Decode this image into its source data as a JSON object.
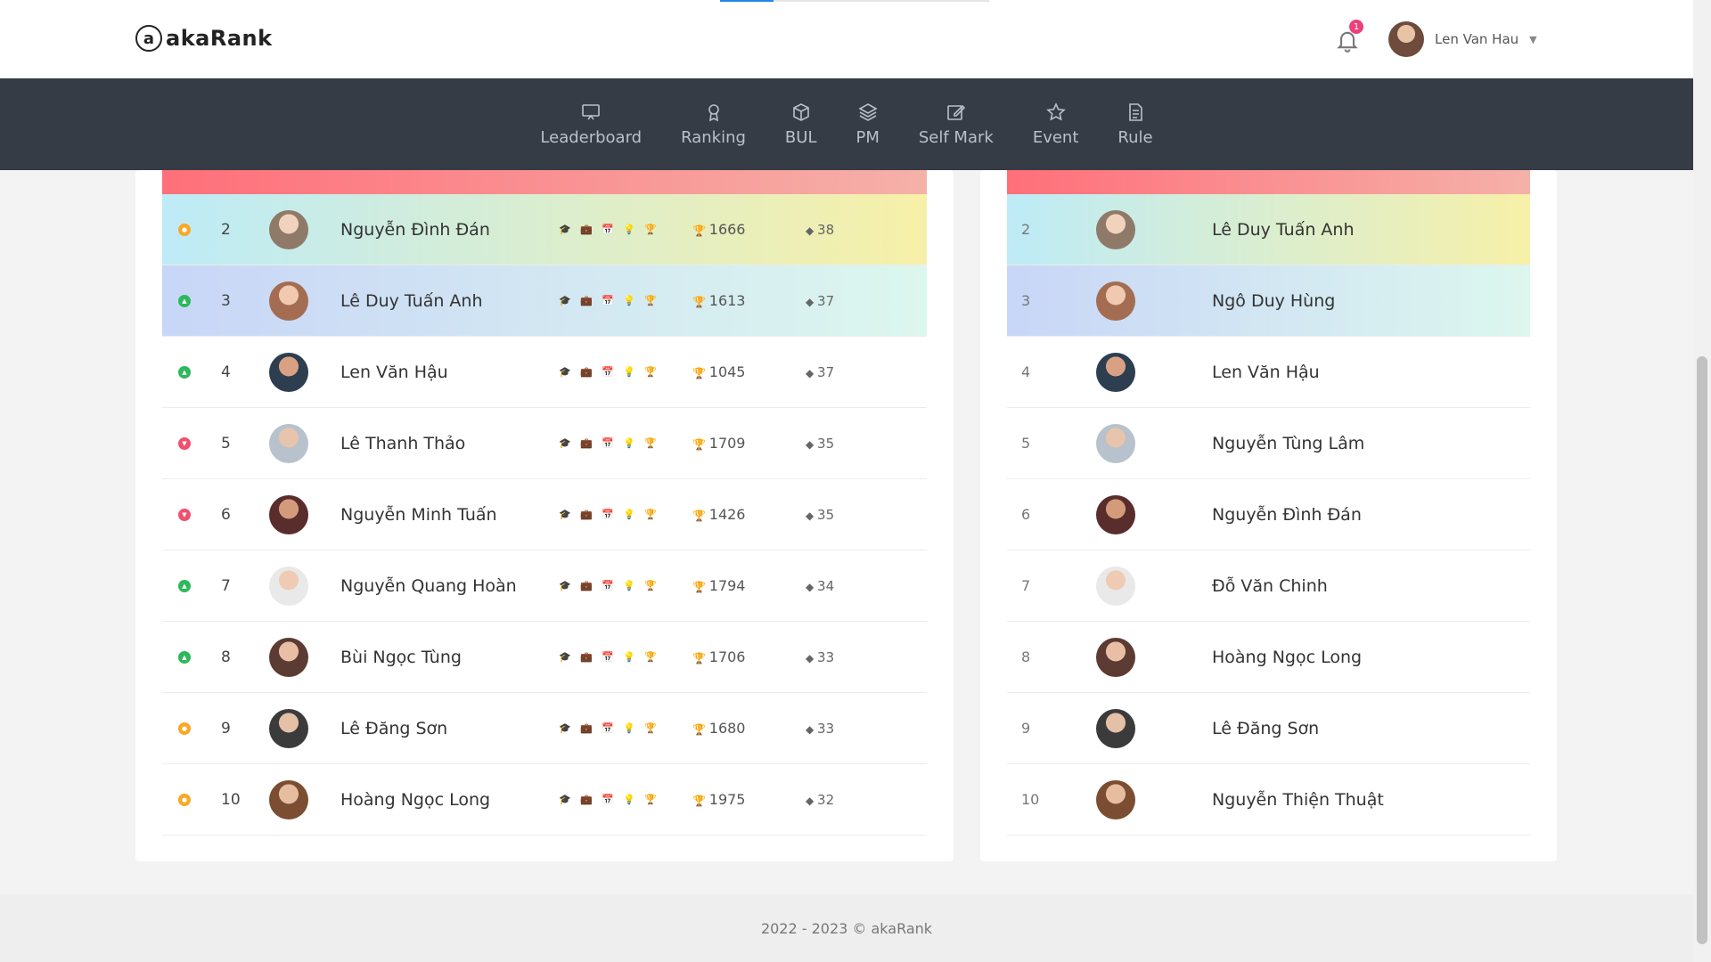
{
  "app": {
    "logo_text": "akaRank",
    "logo_mark": "a"
  },
  "header": {
    "notifications": "1",
    "user_name": "Len Van Hau"
  },
  "nav": [
    {
      "label": "Leaderboard",
      "icon": "monitor-icon"
    },
    {
      "label": "Ranking",
      "icon": "award-icon"
    },
    {
      "label": "BUL",
      "icon": "box-icon"
    },
    {
      "label": "PM",
      "icon": "layers-icon"
    },
    {
      "label": "Self Mark",
      "icon": "edit-icon"
    },
    {
      "label": "Event",
      "icon": "star-icon"
    },
    {
      "label": "Rule",
      "icon": "document-icon"
    }
  ],
  "left_table": [
    {
      "trend": "neutral",
      "rank": "2",
      "name": "Nguyễn Đình Đán",
      "points": "1666",
      "gems": "38",
      "highlight": "yellow"
    },
    {
      "trend": "up",
      "rank": "3",
      "name": "Lê Duy Tuấn Anh",
      "points": "1613",
      "gems": "37",
      "highlight": "teal"
    },
    {
      "trend": "up",
      "rank": "4",
      "name": "Len Văn Hậu",
      "points": "1045",
      "gems": "37",
      "highlight": "none"
    },
    {
      "trend": "down",
      "rank": "5",
      "name": "Lê Thanh Thảo",
      "points": "1709",
      "gems": "35",
      "highlight": "none"
    },
    {
      "trend": "down",
      "rank": "6",
      "name": "Nguyễn Minh Tuấn",
      "points": "1426",
      "gems": "35",
      "highlight": "none"
    },
    {
      "trend": "up",
      "rank": "7",
      "name": "Nguyễn Quang Hoàn",
      "points": "1794",
      "gems": "34",
      "highlight": "none"
    },
    {
      "trend": "up",
      "rank": "8",
      "name": "Bùi Ngọc Tùng",
      "points": "1706",
      "gems": "33",
      "highlight": "none"
    },
    {
      "trend": "neutral",
      "rank": "9",
      "name": "Lê Đăng Sơn",
      "points": "1680",
      "gems": "33",
      "highlight": "none"
    },
    {
      "trend": "neutral",
      "rank": "10",
      "name": "Hoàng Ngọc Long",
      "points": "1975",
      "gems": "32",
      "highlight": "none"
    }
  ],
  "right_table": [
    {
      "rank": "2",
      "name": "Lê Duy Tuấn Anh",
      "highlight": "yellow"
    },
    {
      "rank": "3",
      "name": "Ngô Duy Hùng",
      "highlight": "teal"
    },
    {
      "rank": "4",
      "name": "Len Văn Hậu",
      "highlight": "none"
    },
    {
      "rank": "5",
      "name": "Nguyễn Tùng Lâm",
      "highlight": "none"
    },
    {
      "rank": "6",
      "name": "Nguyễn Đình Đán",
      "highlight": "none"
    },
    {
      "rank": "7",
      "name": "Đỗ Văn Chinh",
      "highlight": "none"
    },
    {
      "rank": "8",
      "name": "Hoàng Ngọc Long",
      "highlight": "none"
    },
    {
      "rank": "9",
      "name": "Lê Đăng Sơn",
      "highlight": "none"
    },
    {
      "rank": "10",
      "name": "Nguyễn Thiện Thuật",
      "highlight": "none"
    }
  ],
  "badge_icons": [
    "graduation-cap-icon",
    "briefcase-icon",
    "calendar-icon",
    "lightbulb-icon",
    "trophy-icon"
  ],
  "colors": {
    "up": "#2eb85c",
    "down": "#f0506e",
    "neutral": "#f9a825",
    "nav_bg": "#353c46",
    "notification": "#ec407a"
  },
  "footer": {
    "text": "2022 - 2023 © akaRank"
  }
}
